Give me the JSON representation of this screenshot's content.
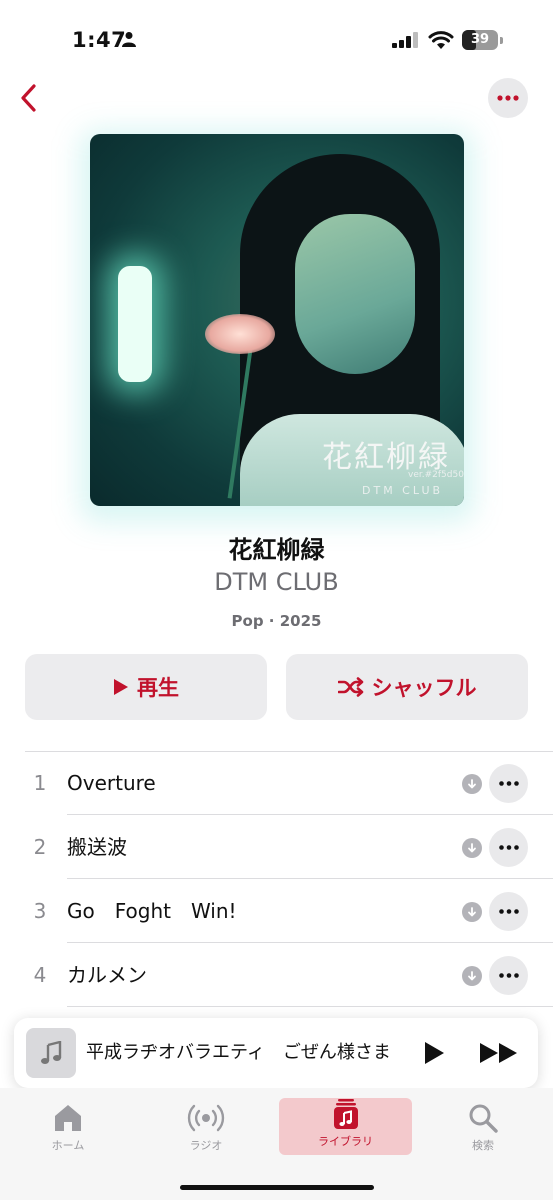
{
  "status_bar": {
    "time": "1:47",
    "battery": "39",
    "battery_level": 0.39
  },
  "album": {
    "title": "花紅柳緑",
    "artist": "DTM CLUB",
    "meta": "Pop · 2025",
    "artwork_logo": "花紅柳緑",
    "artwork_ver": "ver.#2f5d50",
    "artwork_club": "DTM CLUB"
  },
  "actions": {
    "play_label": "再生",
    "shuffle_label": "シャッフル"
  },
  "tracks": [
    {
      "num": "1",
      "name": "Overture"
    },
    {
      "num": "2",
      "name": "搬送波"
    },
    {
      "num": "3",
      "name": "Go　Foght　Win!"
    },
    {
      "num": "4",
      "name": "カルメン"
    }
  ],
  "now_playing": {
    "title": "平成ラヂオバラエティ　ごぜん様さま"
  },
  "tabs": [
    {
      "label": "ホーム",
      "icon": "home-icon"
    },
    {
      "label": "ラジオ",
      "icon": "radio-icon"
    },
    {
      "label": "ライブラリ",
      "icon": "library-icon",
      "active": true
    },
    {
      "label": "検索",
      "icon": "search-icon"
    }
  ],
  "colors": {
    "accent": "#c1122c",
    "active_tab_bg": "#f3c9cc",
    "button_bg": "#ececee"
  }
}
